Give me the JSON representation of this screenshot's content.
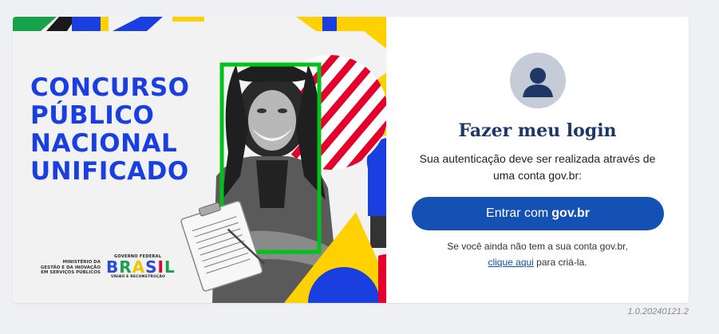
{
  "banner": {
    "headline": [
      "CONCURSO",
      "PÚBLICO",
      "NACIONAL",
      "UNIFICADO"
    ],
    "ministry": [
      "MINISTÉRIO DA",
      "GESTÃO E DA INOVAÇÃO",
      "EM SERVIÇOS PÚBLICOS"
    ],
    "gov_logo": {
      "top": "GOVERNO FEDERAL",
      "word": [
        "B",
        "R",
        "A",
        "S",
        "I",
        "L"
      ],
      "sub": "UNIÃO E RECONSTRUÇÃO"
    }
  },
  "login": {
    "avatar_icon": "user-icon",
    "title": "Fazer meu login",
    "description": "Sua autenticação deve ser realizada através de uma conta gov.br:",
    "button_prefix": "Entrar com",
    "button_bold": "gov.br",
    "note_line1": "Se você ainda não tem a sua conta gov.br,",
    "note_link": "clique aqui",
    "note_suffix": " para criá-la."
  },
  "version": "1.0.20240121.2",
  "colors": {
    "primary": "#1351b4",
    "title": "#1d3767",
    "headline_blue": "#1a3fe0",
    "frame_green": "#00c21a",
    "red": "#e4002b",
    "yellow": "#ffd100"
  }
}
